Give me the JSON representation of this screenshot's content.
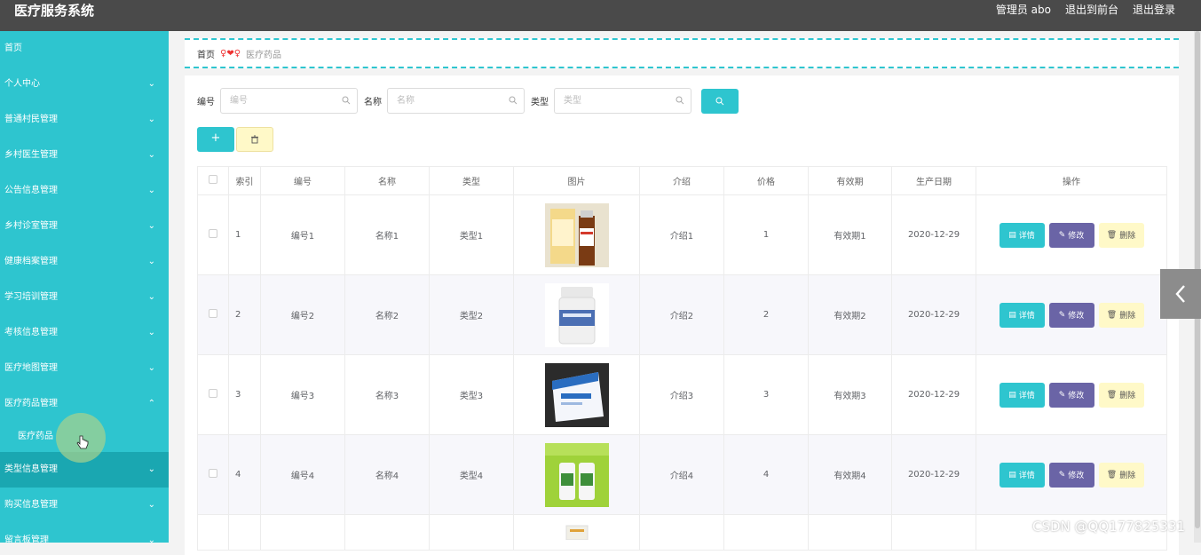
{
  "header": {
    "title": "医疗服务系统",
    "admin": "管理员 abo",
    "to_front": "退出到前台",
    "logout": "退出登录"
  },
  "sidebar": {
    "items": [
      {
        "label": "首页"
      },
      {
        "label": "个人中心"
      },
      {
        "label": "普通村民管理"
      },
      {
        "label": "乡村医生管理"
      },
      {
        "label": "公告信息管理"
      },
      {
        "label": "乡村诊室管理"
      },
      {
        "label": "健康档案管理"
      },
      {
        "label": "学习培训管理"
      },
      {
        "label": "考核信息管理"
      },
      {
        "label": "医疗地图管理"
      },
      {
        "label": "医疗药品管理"
      },
      {
        "label": "医疗药品"
      },
      {
        "label": "类型信息管理"
      },
      {
        "label": "购买信息管理"
      },
      {
        "label": "留言板管理"
      }
    ]
  },
  "breadcrumb": {
    "home": "首页",
    "separator": "♀❤♀",
    "current": "医疗药品"
  },
  "search": {
    "code_label": "编号",
    "code_placeholder": "编号",
    "name_label": "名称",
    "name_placeholder": "名称",
    "type_label": "类型",
    "type_placeholder": "类型"
  },
  "toolbar": {
    "add_label": "+"
  },
  "table": {
    "headers": [
      "索引",
      "编号",
      "名称",
      "类型",
      "图片",
      "介绍",
      "价格",
      "有效期",
      "生产日期",
      "操作"
    ],
    "rows": [
      {
        "index": "1",
        "code": "编号1",
        "name": "名称1",
        "type": "类型1",
        "intro": "介绍1",
        "price": "1",
        "validity": "有效期1",
        "date": "2020-12-29"
      },
      {
        "index": "2",
        "code": "编号2",
        "name": "名称2",
        "type": "类型2",
        "intro": "介绍2",
        "price": "2",
        "validity": "有效期2",
        "date": "2020-12-29"
      },
      {
        "index": "3",
        "code": "编号3",
        "name": "名称3",
        "type": "类型3",
        "intro": "介绍3",
        "price": "3",
        "validity": "有效期3",
        "date": "2020-12-29"
      },
      {
        "index": "4",
        "code": "编号4",
        "name": "名称4",
        "type": "类型4",
        "intro": "介绍4",
        "price": "4",
        "validity": "有效期4",
        "date": "2020-12-29"
      }
    ],
    "actions": {
      "detail": "详情",
      "edit": "修改",
      "remove": "删除"
    }
  },
  "watermark": "CSDN @QQ177825331",
  "colors": {
    "accent": "#2ec5cf",
    "edit": "#6a64a6",
    "danger_bg": "#fff9c8",
    "header": "#4a4a4a"
  }
}
